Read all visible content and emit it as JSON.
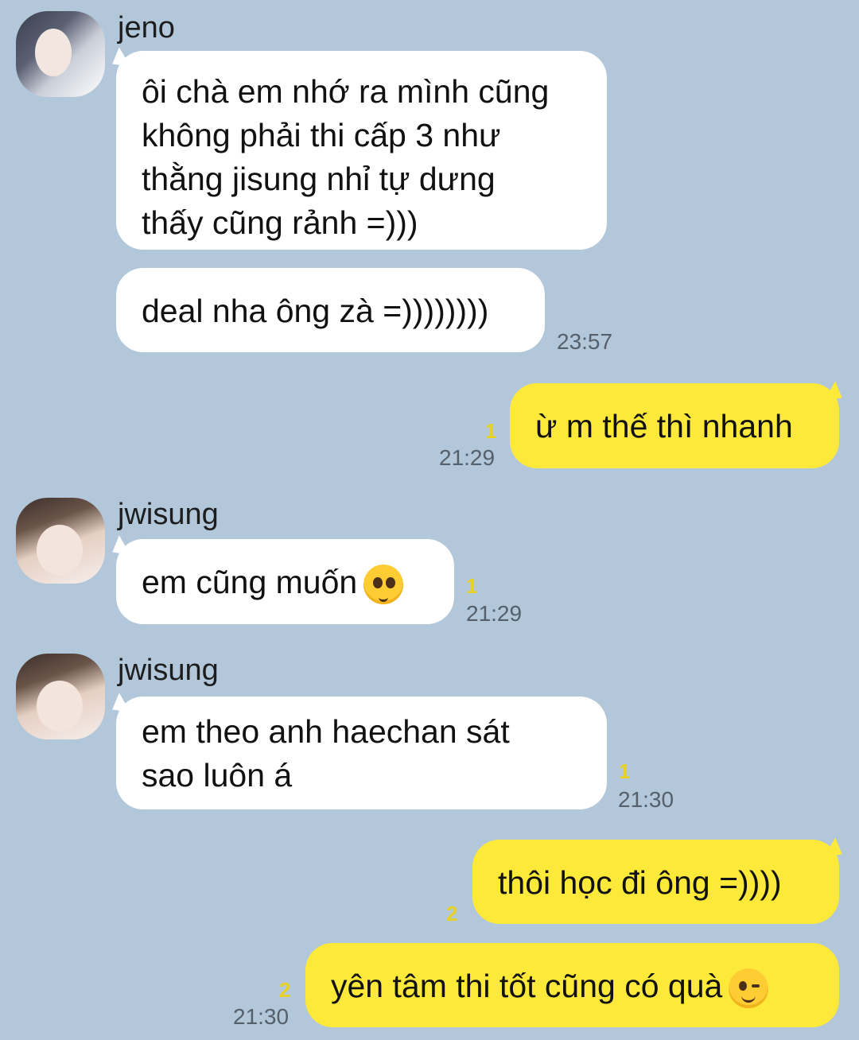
{
  "messages": [
    {
      "sender": "jeno",
      "lines": [
        "ôi chà em nhớ ra mình cũng",
        "không phải thi cấp 3 như",
        "thằng jisung nhỉ tự dưng",
        "thấy cũng rảnh =)))"
      ]
    },
    {
      "lines": [
        "deal nha ông zà =))))))))"
      ],
      "time": "23:57"
    },
    {
      "lines": [
        "ừ m thế thì nhanh"
      ],
      "time": "21:29",
      "unread": "1"
    },
    {
      "sender": "jwisung",
      "lines": [
        "em cũng muốn"
      ],
      "emoji": "pleading-face-icon",
      "time": "21:29",
      "unread": "1"
    },
    {
      "sender": "jwisung",
      "lines": [
        "em theo anh haechan sát",
        "sao luôn á"
      ],
      "time": "21:30",
      "unread": "1"
    },
    {
      "lines": [
        "thôi học đi ông =))))"
      ],
      "unread": "2"
    },
    {
      "lines": [
        "yên tâm thi tốt cũng có quà"
      ],
      "emoji": "winking-face-icon",
      "time": "21:30",
      "unread": "2"
    }
  ],
  "colors": {
    "background": "#b2c7da",
    "incoming": "#ffffff",
    "outgoing": "#fde93a",
    "unread": "#e7d125"
  }
}
